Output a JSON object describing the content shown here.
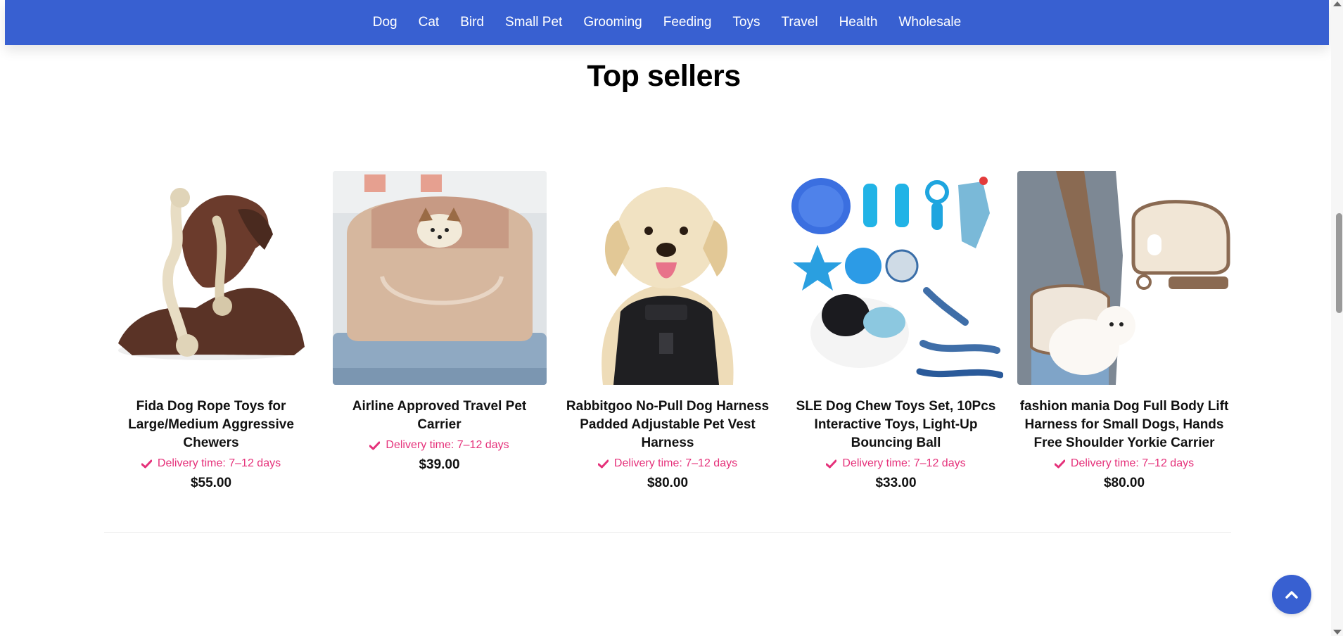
{
  "nav": {
    "items": [
      {
        "label": "Dog"
      },
      {
        "label": "Cat"
      },
      {
        "label": "Bird"
      },
      {
        "label": "Small Pet"
      },
      {
        "label": "Grooming"
      },
      {
        "label": "Feeding"
      },
      {
        "label": "Toys"
      },
      {
        "label": "Travel"
      },
      {
        "label": "Health"
      },
      {
        "label": "Wholesale"
      }
    ]
  },
  "section": {
    "title": "Top sellers"
  },
  "products": [
    {
      "name": "Fida Dog Rope Toys for Large/Medium Aggressive Chewers",
      "delivery": "Delivery time: 7–12 days",
      "price": "$55.00",
      "image": "dog-with-rope-toy"
    },
    {
      "name": "Airline Approved Travel Pet Carrier",
      "delivery": "Delivery time: 7–12 days",
      "price": "$39.00",
      "image": "pet-carrier-on-suitcase"
    },
    {
      "name": "Rabbitgoo No-Pull Dog Harness Padded Adjustable Pet Vest Harness",
      "delivery": "Delivery time: 7–12 days",
      "price": "$80.00",
      "image": "labrador-in-harness"
    },
    {
      "name": "SLE Dog Chew Toys Set, 10Pcs Interactive Toys, Light-Up Bouncing Ball",
      "delivery": "Delivery time: 7–12 days",
      "price": "$33.00",
      "image": "chew-toy-set"
    },
    {
      "name": "fashion mania Dog Full Body Lift Harness for Small Dogs, Hands Free Shoulder Yorkie Carrier",
      "delivery": "Delivery time: 7–12 days",
      "price": "$80.00",
      "image": "shoulder-dog-carrier"
    }
  ],
  "colors": {
    "nav_bg": "#3860d1",
    "delivery": "#e5317a",
    "price": "#111111"
  },
  "icons": {
    "delivery": "check-icon",
    "back_to_top": "chevron-up-icon"
  }
}
